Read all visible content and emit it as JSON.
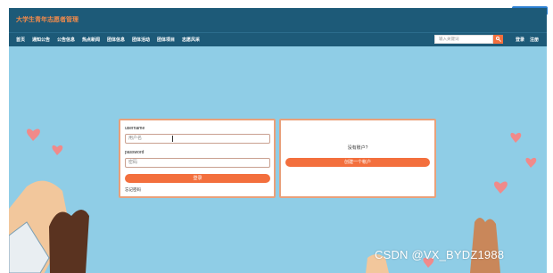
{
  "corner_button": "",
  "header": {
    "title": "大学生青年志愿者管理"
  },
  "nav": {
    "items": [
      "首页",
      "通知公告",
      "公告信息",
      "热点新闻",
      "团体信息",
      "团体活动",
      "团体项目",
      "志愿风采"
    ],
    "search_placeholder": "输入关键词",
    "login": "登录",
    "register": "注册"
  },
  "login_panel": {
    "username_label": "username",
    "username_placeholder": "用户名",
    "password_label": "password",
    "password_placeholder": "密码",
    "submit": "登录",
    "forgot": "忘记密码"
  },
  "signup_panel": {
    "prompt": "没有账户?",
    "create": "创建一个帐户"
  },
  "watermark": "CSDN @VX_BYDZ1988",
  "colors": {
    "header": "#1d5a78",
    "accent": "#f36f3d",
    "background": "#8fcde6"
  }
}
